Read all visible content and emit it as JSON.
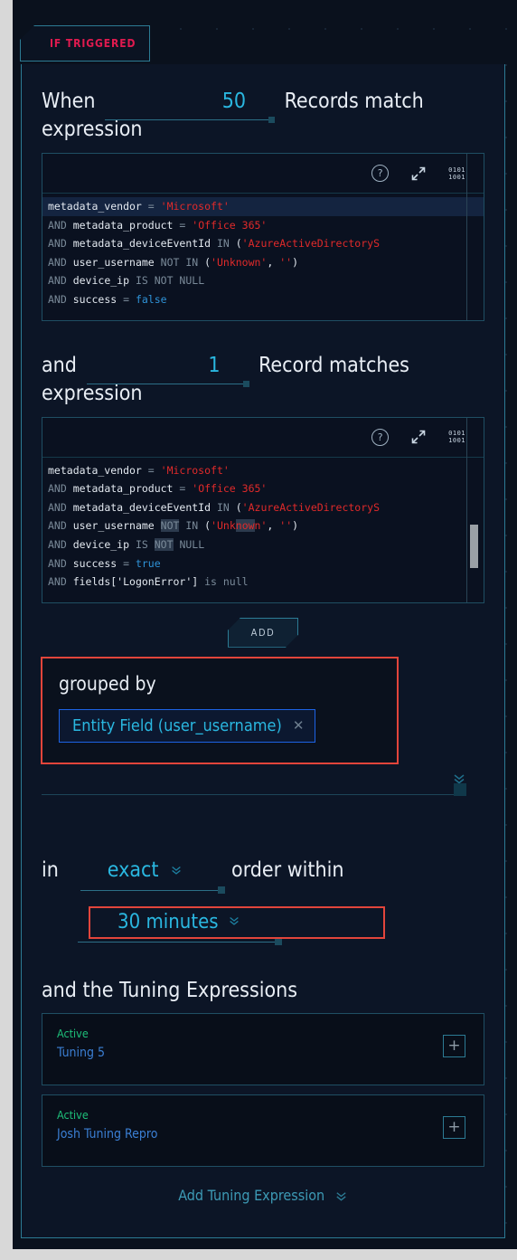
{
  "tab": {
    "label": "IF TRIGGERED"
  },
  "rule1": {
    "prefix": "When",
    "count": "50",
    "suffix": "Records match expression",
    "toolbar": {
      "help_icon": "help-circle-icon",
      "expand_icon": "expand-arrows-icon",
      "raw_icon": "binary-code-icon",
      "raw_text_top": "0101",
      "raw_text_bottom": "1001"
    },
    "code_lines": [
      [
        {
          "t": "metadata_vendor ",
          "c": "ident"
        },
        {
          "t": "= ",
          "c": "kw"
        },
        {
          "t": "'Microsoft'",
          "c": "str"
        }
      ],
      [
        {
          "t": "AND ",
          "c": "kw"
        },
        {
          "t": "metadata_product ",
          "c": "ident"
        },
        {
          "t": "= ",
          "c": "kw"
        },
        {
          "t": "'Office 365'",
          "c": "str"
        }
      ],
      [
        {
          "t": "AND ",
          "c": "kw"
        },
        {
          "t": "metadata_deviceEventId ",
          "c": "ident"
        },
        {
          "t": "IN ",
          "c": "kw"
        },
        {
          "t": "(",
          "c": "ident"
        },
        {
          "t": "'AzureActiveDirectoryS",
          "c": "str"
        }
      ],
      [
        {
          "t": "AND ",
          "c": "kw"
        },
        {
          "t": "user_username ",
          "c": "ident"
        },
        {
          "t": "NOT IN ",
          "c": "kw"
        },
        {
          "t": "(",
          "c": "ident"
        },
        {
          "t": "'Unknown'",
          "c": "str"
        },
        {
          "t": ", ",
          "c": "ident"
        },
        {
          "t": "''",
          "c": "str"
        },
        {
          "t": ")",
          "c": "ident"
        }
      ],
      [
        {
          "t": "AND ",
          "c": "kw"
        },
        {
          "t": "device_ip ",
          "c": "ident"
        },
        {
          "t": "IS NOT NULL",
          "c": "kw"
        }
      ],
      [
        {
          "t": "AND ",
          "c": "kw"
        },
        {
          "t": "success ",
          "c": "ident"
        },
        {
          "t": "= ",
          "c": "kw"
        },
        {
          "t": "false",
          "c": "bool"
        }
      ]
    ]
  },
  "rule2": {
    "prefix": "and",
    "count": "1",
    "suffix": "Record matches expression",
    "code_lines": [
      [
        {
          "t": "metadata_vendor ",
          "c": "ident"
        },
        {
          "t": "= ",
          "c": "kw"
        },
        {
          "t": "'Microsoft'",
          "c": "str"
        }
      ],
      [
        {
          "t": "AND ",
          "c": "kw"
        },
        {
          "t": "metadata_product ",
          "c": "ident"
        },
        {
          "t": "= ",
          "c": "kw"
        },
        {
          "t": "'Office 365'",
          "c": "str"
        }
      ],
      [
        {
          "t": "AND ",
          "c": "kw"
        },
        {
          "t": "metadata_deviceEventId ",
          "c": "ident"
        },
        {
          "t": "IN ",
          "c": "kw"
        },
        {
          "t": "(",
          "c": "ident"
        },
        {
          "t": "'AzureActiveDirectoryS",
          "c": "str"
        }
      ],
      [
        {
          "t": "AND ",
          "c": "kw"
        },
        {
          "t": "user_username ",
          "c": "ident"
        },
        {
          "t": "NOT",
          "c": "kw sel"
        },
        {
          "t": " IN ",
          "c": "kw"
        },
        {
          "t": "(",
          "c": "ident"
        },
        {
          "t": "'Unk",
          "c": "str"
        },
        {
          "t": "now",
          "c": "str sel"
        },
        {
          "t": "n'",
          "c": "str"
        },
        {
          "t": ", ",
          "c": "ident"
        },
        {
          "t": "''",
          "c": "str"
        },
        {
          "t": ")",
          "c": "ident"
        }
      ],
      [
        {
          "t": "AND ",
          "c": "kw"
        },
        {
          "t": "device_ip ",
          "c": "ident"
        },
        {
          "t": "IS ",
          "c": "kw"
        },
        {
          "t": "NOT",
          "c": "kw sel"
        },
        {
          "t": " NULL",
          "c": "kw"
        }
      ],
      [
        {
          "t": "AND ",
          "c": "kw"
        },
        {
          "t": "success ",
          "c": "ident"
        },
        {
          "t": "= ",
          "c": "kw"
        },
        {
          "t": "true",
          "c": "bool"
        }
      ],
      [
        {
          "t": "AND ",
          "c": "kw"
        },
        {
          "t": "fields['LogonError'] ",
          "c": "ident"
        },
        {
          "t": "is null",
          "c": "null"
        }
      ]
    ]
  },
  "add_button": {
    "label": "ADD"
  },
  "grouped": {
    "title": "grouped by",
    "chip_label": "Entity Field (user_username)",
    "chip_remove_icon": "close-icon",
    "expand_icon": "chevron-double-down-icon"
  },
  "order": {
    "prefix": "in",
    "value": "exact",
    "suffix": "order within",
    "caret_icon": "chevron-double-down-icon",
    "time_value": "30 minutes",
    "time_caret_icon": "chevron-double-down-icon"
  },
  "tuning": {
    "title": "and the Tuning Expressions",
    "items": [
      {
        "status": "Active",
        "name": "Tuning 5",
        "action_icon": "plus-icon"
      },
      {
        "status": "Active",
        "name": "Josh Tuning Repro",
        "action_icon": "plus-icon"
      }
    ],
    "add_label": "Add Tuning Expression",
    "add_icon": "chevron-double-down-icon"
  },
  "colors": {
    "accent_red": "#cf0a3e",
    "accent_cyan": "#2ab7e0",
    "border_teal": "#2c7b94",
    "highlight_red": "#e2453b",
    "status_green": "#1ec07a",
    "link_blue": "#3b7fd4",
    "canvas_bg": "#0a111d"
  }
}
